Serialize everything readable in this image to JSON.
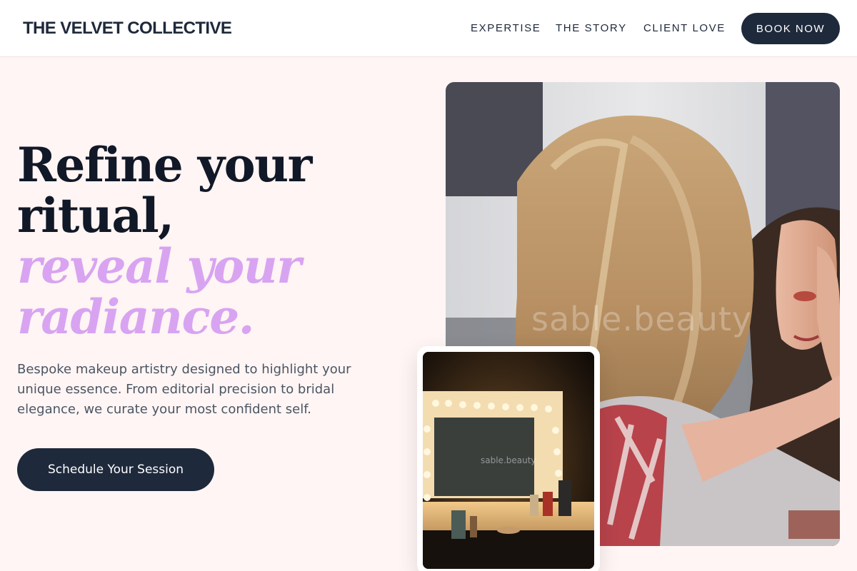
{
  "brand": "THE VELVET COLLECTIVE",
  "nav": {
    "links": [
      "EXPERTISE",
      "THE STORY",
      "CLIENT LOVE"
    ],
    "cta": "BOOK NOW"
  },
  "hero": {
    "headline_line1": "Refine your",
    "headline_line2": "ritual,",
    "headline_accent1": "reveal your",
    "headline_accent2": "radiance.",
    "description": "Bespoke makeup artistry designed to highlight your unique essence. From editorial precision to bridal elegance, we curate your most confident self.",
    "cta": "Schedule Your Session"
  },
  "images": {
    "main_watermark": "sable.beauty",
    "card_watermark": "sable.beauty"
  },
  "colors": {
    "navy": "#1e293b",
    "accent_lilac": "#d8a4f1",
    "background_blush": "#fff5f4"
  }
}
